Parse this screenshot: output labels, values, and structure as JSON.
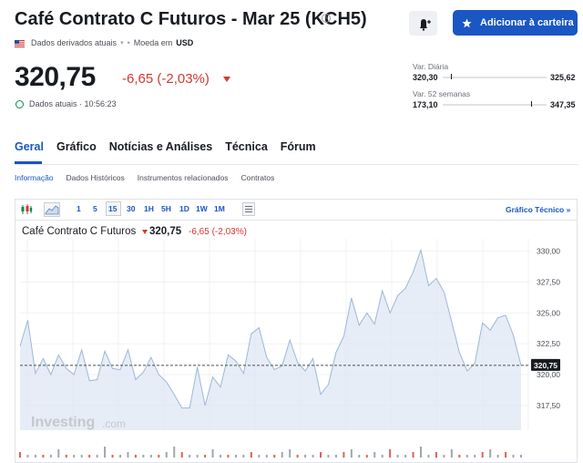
{
  "header": {
    "title": "Café Contrato C Futuros - Mar 25 (KCH5)",
    "meta_exchange": "Dados derivados atuais",
    "meta_currency_label": "Moeda em",
    "meta_currency": "USD",
    "add_portfolio_label": "Adicionar à carteira"
  },
  "quote": {
    "price": "320,75",
    "change": "-6,65 (-2,03%)",
    "time": "Dados atuais · 10:56:23"
  },
  "ranges": {
    "daily_label": "Var. Diária",
    "daily_low": "320,30",
    "daily_high": "325,62",
    "daily_level": 0.08,
    "week52_label": "Var. 52 semanas",
    "week52_low": "173,10",
    "week52_high": "347,35",
    "week52_level": 0.85
  },
  "tabs": [
    "Geral",
    "Gráfico",
    "Notícias e Análises",
    "Técnica",
    "Fórum"
  ],
  "subtabs": [
    "Informação",
    "Dados Históricos",
    "Instrumentos relacionados",
    "Contratos"
  ],
  "chart_toolbar": {
    "intervals": [
      "1",
      "5",
      "15",
      "30",
      "1H",
      "5H",
      "1D",
      "1W",
      "1M"
    ],
    "active_interval": "15",
    "technical_link": "Gráfico Técnico »"
  },
  "chart_legend": {
    "name": "Café Contrato C Futuros",
    "price": "320,75",
    "change": "-6,65 (-2,03%)"
  },
  "watermark": {
    "brand": "Investing",
    "suffix": ".com"
  },
  "colors": {
    "accent": "#1a56c4",
    "down": "#d6372f",
    "up": "#0a8a4f",
    "area": "#dbe6f3",
    "line": "#9fb7d6"
  },
  "chart_data": {
    "type": "area",
    "title": "",
    "xlabel": "",
    "ylabel": "",
    "ylim": [
      315.5,
      331.0
    ],
    "yticks": [
      "330,00",
      "327,50",
      "325,00",
      "322,50",
      "320,00",
      "317,50"
    ],
    "ytick_values": [
      330.0,
      327.5,
      325.0,
      322.5,
      320.0,
      317.5
    ],
    "last_price": 320.75,
    "last_label": "320,75",
    "reference_line": 320.75,
    "series": [
      {
        "values": [
          322.3,
          324.4,
          320.1,
          321.3,
          320.0,
          321.6,
          320.5,
          320.0,
          322.0,
          319.5,
          319.6,
          321.9,
          320.5,
          320.4,
          322.0,
          319.6,
          320.2,
          321.4,
          320.0,
          319.4,
          318.4,
          317.3,
          317.3,
          320.6,
          317.5,
          319.8,
          319.0,
          321.6,
          321.1,
          320.1,
          323.3,
          323.8,
          321.4,
          320.4,
          320.7,
          322.8,
          321.0,
          320.3,
          321.3,
          318.4,
          319.2,
          321.8,
          323.1,
          326.2,
          324.0,
          325.0,
          324.1,
          326.8,
          325.0,
          326.4,
          327.0,
          328.3,
          330.1,
          327.2,
          327.8,
          326.7,
          324.3,
          321.8,
          320.3,
          320.9,
          324.2,
          323.6,
          324.6,
          324.8,
          323.2,
          320.75
        ]
      }
    ],
    "volume": [
      2,
      1,
      1,
      1,
      1,
      3,
      1,
      1,
      1,
      1,
      1,
      4,
      1,
      1,
      2,
      1,
      1,
      1,
      1,
      2,
      4,
      2,
      1,
      1,
      1,
      3,
      1,
      1,
      1,
      1,
      2,
      1,
      1,
      1,
      2,
      3,
      1,
      1,
      1,
      2,
      1,
      1,
      2,
      3,
      1,
      1,
      2,
      1,
      3,
      1,
      1,
      2,
      4,
      1,
      2,
      1,
      3,
      1,
      1,
      1,
      2,
      3,
      1,
      2,
      1,
      1
    ]
  }
}
